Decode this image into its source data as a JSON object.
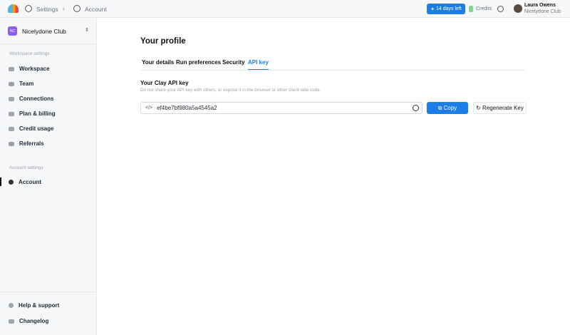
{
  "breadcrumb": {
    "settings": "Settings",
    "account": "Account"
  },
  "header": {
    "trial": "14 days left",
    "credits": "Credits",
    "user_name": "Laura Owens",
    "user_org": "Nicelydone Club"
  },
  "sidebar": {
    "workspace_initials": "NC",
    "workspace_name": "Nicelydone Club",
    "workspace_section": "Workspace settings",
    "workspace_items": [
      {
        "label": "Workspace"
      },
      {
        "label": "Team"
      },
      {
        "label": "Connections"
      },
      {
        "label": "Plan & billing"
      },
      {
        "label": "Credit usage"
      },
      {
        "label": "Referrals"
      }
    ],
    "account_section": "Account settings",
    "account_item": "Account",
    "help": "Help & support",
    "changelog": "Changelog"
  },
  "page": {
    "title": "Your profile",
    "tabs": [
      "Your details",
      "Run preferences",
      "Security",
      "API key"
    ],
    "active_tab": "API key",
    "api_title": "Your Clay API key",
    "api_desc": "Do not share your API key with others, or expose it in the browser or other client-side code.",
    "api_key": "ef4be7bf980a5a4545a2",
    "copy": "Copy",
    "regenerate": "Regenerate Key"
  },
  "colors": {
    "accent": "#1a7ee6"
  }
}
